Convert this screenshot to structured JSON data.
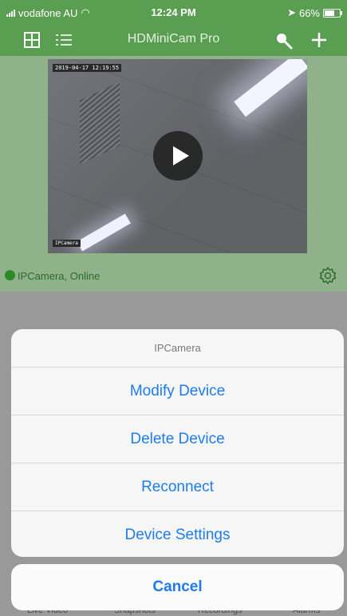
{
  "status_bar": {
    "carrier": "vodafone AU",
    "time": "12:24 PM",
    "battery": "66%",
    "battery_level": 0.66
  },
  "nav": {
    "title": "HDMiniCam Pro",
    "icons": [
      "grid-view-icon",
      "list-view-icon",
      "search-icon",
      "add-icon"
    ]
  },
  "camera": {
    "timestamp": "2019-04-17 12:19:55",
    "overlay_label": "IPCamera",
    "status": "IPCamera, Online",
    "status_color": "#2e8a24"
  },
  "action_sheet": {
    "title": "IPCamera",
    "items": [
      "Modify Device",
      "Delete Device",
      "Reconnect",
      "Device Settings"
    ],
    "cancel": "Cancel",
    "accent": "#1d7cf2"
  },
  "tab_bar": {
    "items": [
      "Live Video",
      "Snapshots",
      "Recordings",
      "Alarms"
    ]
  },
  "colors": {
    "header": "#5a9e52",
    "camera_panel": "#8fb28a"
  }
}
